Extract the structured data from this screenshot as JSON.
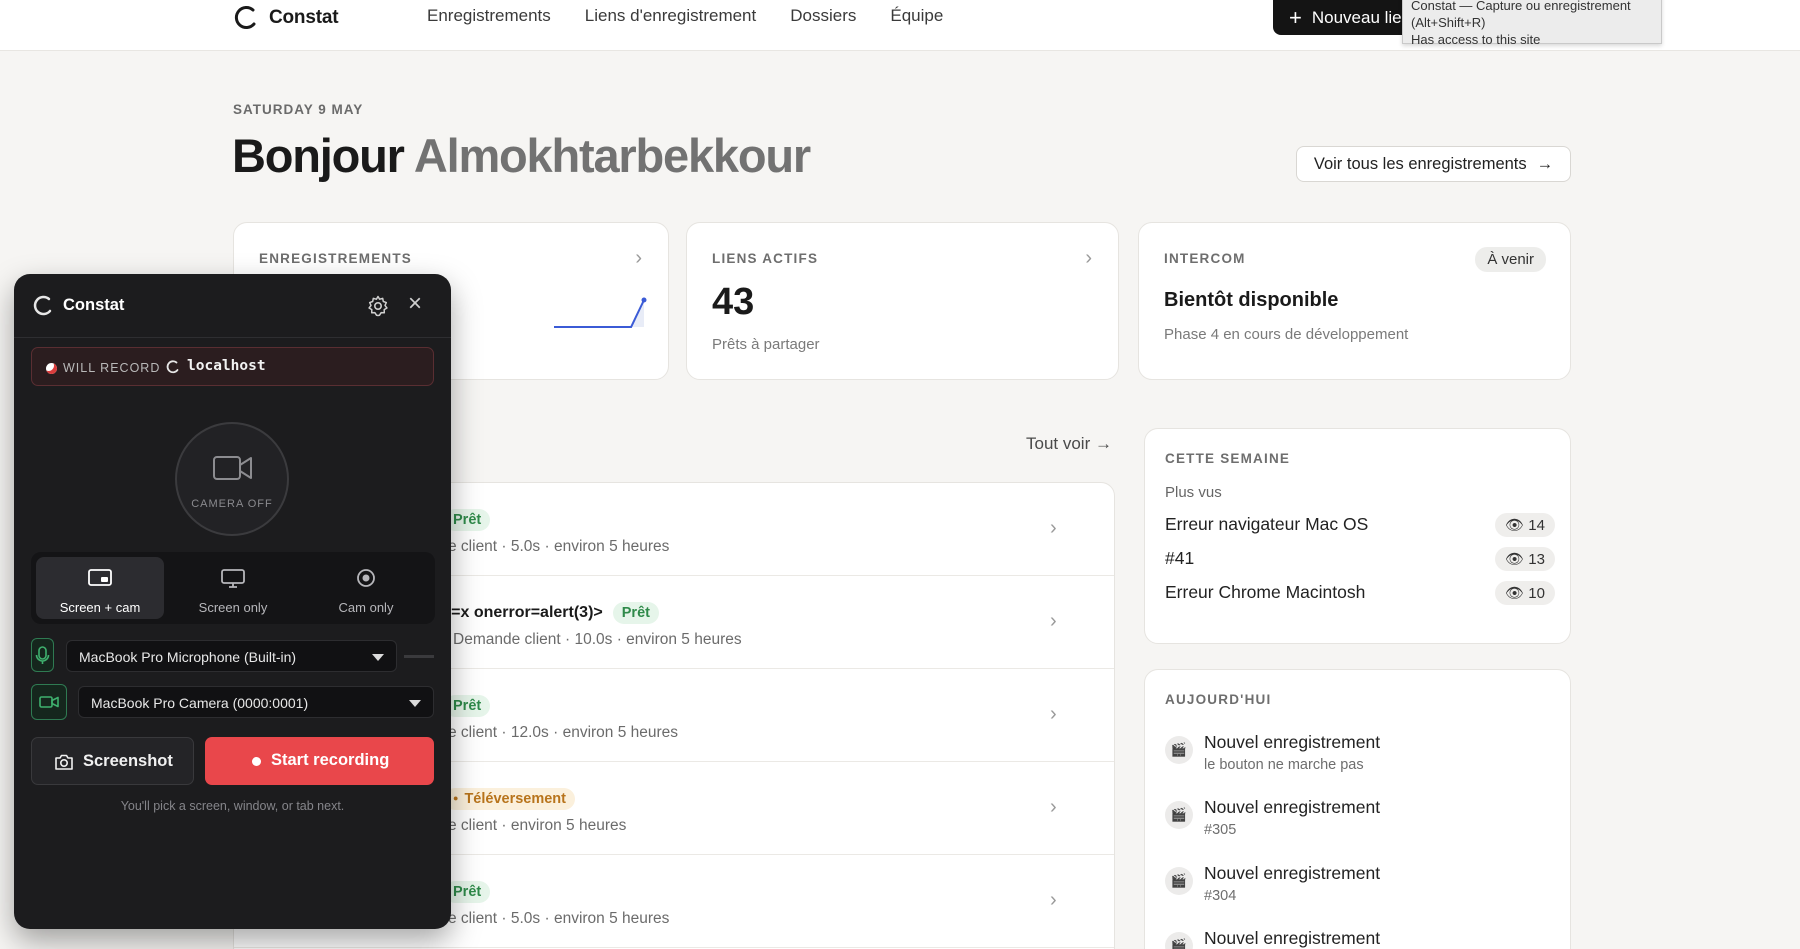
{
  "nav": {
    "brand": "Constat",
    "links": [
      "Enregistrements",
      "Liens d'enregistrement",
      "Dossiers",
      "Équipe"
    ],
    "new_button": "Nouveau lie",
    "tooltip_line1": "Constat — Capture ou enregistrement",
    "tooltip_line2": "(Alt+Shift+R)",
    "tooltip_line3": "Has access to this site"
  },
  "greeting": {
    "date": "SATURDAY 9 MAY",
    "hello": "Bonjour",
    "name": "Almokhtarbekkour",
    "see_all": "Voir tous les enregistrements",
    "see_all_arrow": "→"
  },
  "stats": {
    "recordings": {
      "label": "ENREGISTREMENTS",
      "chevron": "›",
      "sparkline": [
        0,
        0,
        0,
        0,
        0,
        0,
        0,
        1
      ]
    },
    "links": {
      "label": "LIENS ACTIFS",
      "chevron": "›",
      "value": "43",
      "sub": "Prêts à partager"
    },
    "intercom": {
      "label": "INTERCOM",
      "badge": "À venir",
      "title": "Bientôt disponible",
      "sub": "Phase 4 en cours de développement"
    }
  },
  "list": {
    "see_all": "Tout voir →",
    "rows": [
      {
        "title": "",
        "status": "Prêt",
        "status_type": "ready",
        "meta": "e client  ·  5.0s  ·  environ 5 heures"
      },
      {
        "title": "rc=x onerror=alert(3)>",
        "status": "Prêt",
        "status_type": "ready",
        "meta": "Demande client  ·  10.0s  ·  environ 5 heures"
      },
      {
        "title": "",
        "status": "Prêt",
        "status_type": "ready",
        "meta": "e client  ·  12.0s  ·  environ 5 heures"
      },
      {
        "title": "",
        "status": "Téléversement",
        "status_type": "upload",
        "meta": "e client  ·  environ 5 heures"
      },
      {
        "title": "",
        "status": "Prêt",
        "status_type": "ready",
        "meta": "e client  ·  5.0s  ·  environ 5 heures"
      }
    ]
  },
  "week": {
    "label": "CETTE SEMAINE",
    "sub": "Plus vus",
    "items": [
      {
        "name": "Erreur navigateur Mac OS",
        "views": "👁 14"
      },
      {
        "name": "#41",
        "views": "👁 13"
      },
      {
        "name": "Erreur Chrome Macintosh",
        "views": "👁 10"
      }
    ]
  },
  "today": {
    "label": "AUJOURD'HUI",
    "icon": "🎬",
    "items": [
      {
        "title": "Nouvel enregistrement",
        "sub": "le bouton ne marche pas"
      },
      {
        "title": "Nouvel enregistrement",
        "sub": "#305"
      },
      {
        "title": "Nouvel enregistrement",
        "sub": "#304"
      },
      {
        "title": "Nouvel enregistrement",
        "sub": ""
      }
    ]
  },
  "recorder": {
    "title": "Constat",
    "will_record": "WILL RECORD",
    "host": "localhost",
    "camera_off": "CAMERA OFF",
    "modes": [
      "Screen + cam",
      "Screen only",
      "Cam only"
    ],
    "active_mode": "Screen + cam",
    "mic": "MacBook Pro Microphone (Built-in)",
    "camera": "MacBook Pro Camera (0000:0001)",
    "screenshot": "Screenshot",
    "start": "Start recording",
    "hint": "You'll pick a screen, window, or tab next.",
    "colors": {
      "accent_red": "#e9474b",
      "panel_bg": "#1c1c1e",
      "green": "#2f7a52"
    }
  }
}
